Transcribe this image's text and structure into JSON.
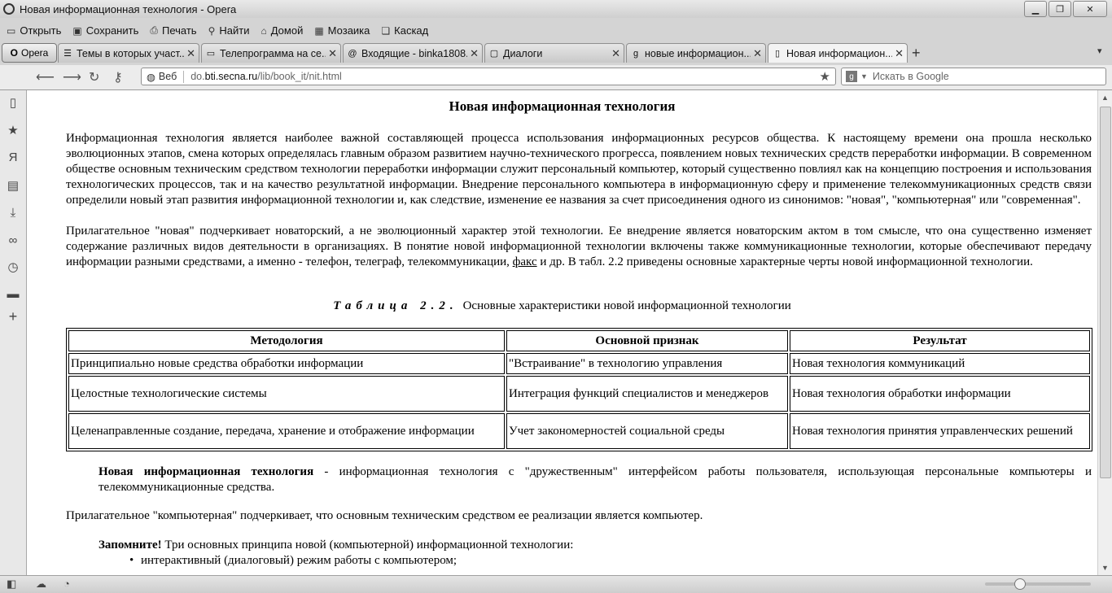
{
  "window": {
    "title": "Новая информационная технология - Opera"
  },
  "menu": [
    "Открыть",
    "Сохранить",
    "Печать",
    "Найти",
    "Домой",
    "Мозаика",
    "Каскад"
  ],
  "opera_button": "Opera",
  "tabs": [
    {
      "label": "Темы в которых участ...",
      "favicon": "forum-icon"
    },
    {
      "label": "Телепрограмма на се...",
      "favicon": "tv-icon"
    },
    {
      "label": "Входящие - binka1808...",
      "favicon": "mail-icon"
    },
    {
      "label": "Диалоги",
      "favicon": "dialog-icon"
    },
    {
      "label": "новые информацион...",
      "favicon": "google-icon"
    },
    {
      "label": "Новая информацион...",
      "favicon": "page-icon",
      "active": true
    }
  ],
  "address": {
    "mode": "Веб",
    "url_prefix": "do.",
    "url_domain": "bti.secna.ru",
    "url_path": "/lib/book_it/nit.html"
  },
  "search": {
    "placeholder": "Искать в Google"
  },
  "page": {
    "title": "Новая информационная технология",
    "p1": "Информационная технология является наиболее важной составляющей процесса использования информационных ресурсов общества. К настоящему времени она прошла несколько эволюционных этапов, смена которых определялась главным образом развитием научно-технического прогресса, появлением новых технических средств переработки информации. В современном обществе основным техническим средством технологии переработки информации служит персональный компьютер, который существенно повлиял как на концепцию построения и использования технологических процессов, так и на качество результатной информации. Внедрение персонального компьютера в информационную сферу и применение телекоммуникационных средств связи определили новый этап развития информационной технологии и, как следствие, изменение ее названия за счет присоединения одного из синонимов: \"новая\", \"компьютерная\" или \"современная\".",
    "p2_before": "Прилагательное \"новая\" подчеркивает новаторский, а не эволюционный характер этой технологии. Ее внедрение является новаторским актом в том смысле, что она существенно изменяет содержание различных видов деятельности в организациях. В понятие новой информационной технологии включены также коммуникационные технологии, которые обеспечивают передачу информации разными средствами, а именно - телефон, телеграф, телекоммуникации, ",
    "p2_link": "факс",
    "p2_after": " и др. В табл. 2.2 приведены основные характерные черты новой информационной технологии.",
    "caption_label": "Таблица 2.2.",
    "caption_text": "Основные характеристики новой информационной технологии",
    "table": {
      "headers": [
        "Методология",
        "Основной признак",
        "Результат"
      ],
      "rows": [
        [
          "Принципиально новые средства обработки информации",
          "\"Встраивание\" в технологию управления",
          "Новая технология коммуникаций"
        ],
        [
          "Целостные технологические системы",
          "Интеграция функций специалистов и менеджеров",
          "Новая технология обработки информации"
        ],
        [
          "Целенаправленные создание, передача, хранение и отображение информации",
          "Учет закономерностей социальной среды",
          "Новая технология принятия управленческих решений"
        ]
      ]
    },
    "def_term": "Новая информационная технология",
    "def_text": " - информационная технология с \"дружественным\" интерфейсом работы пользователя, использующая персональные компьютеры и телекоммуникационные средства.",
    "p3": "Прилагательное \"компьютерная\" подчеркивает, что основным техническим средством ее реализации является компьютер.",
    "remember_label": "Запомните!",
    "remember_text": " Три основных принципа новой (компьютерной) информационной технологии:",
    "bullets": [
      "интерактивный (диалоговый) режим работы с компьютером;"
    ]
  }
}
